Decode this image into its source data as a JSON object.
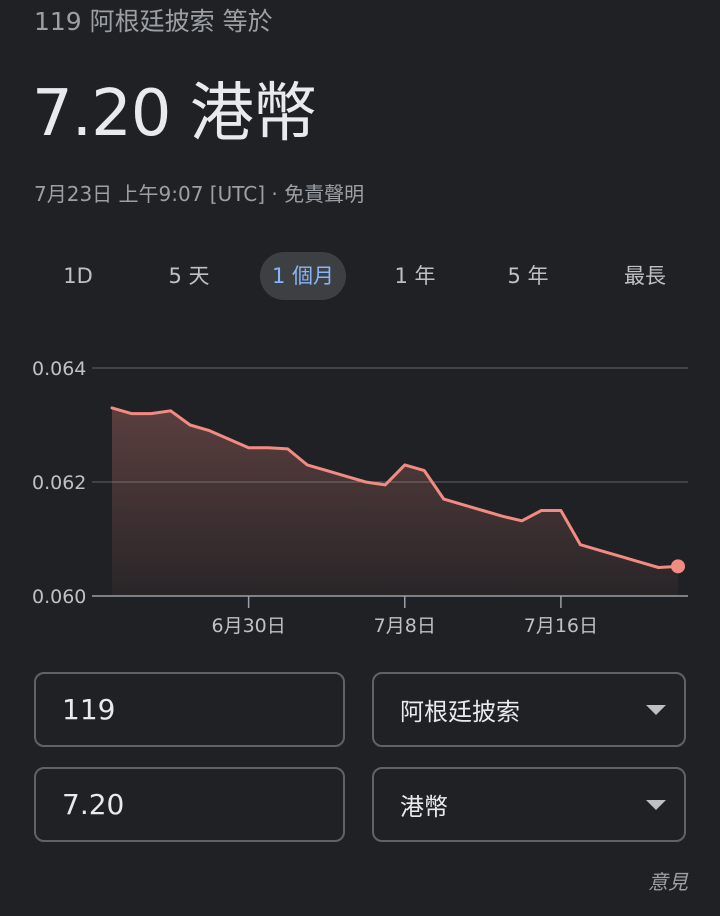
{
  "header": {
    "subtitle": "119 阿根廷披索 等於",
    "value": "7.20 港幣",
    "timestamp": "7月23日 上午9:07 [UTC] · 免責聲明"
  },
  "tabs": [
    {
      "label": "1D",
      "active": false
    },
    {
      "label": "5 天",
      "active": false
    },
    {
      "label": "1 個月",
      "active": true
    },
    {
      "label": "1 年",
      "active": false
    },
    {
      "label": "5 年",
      "active": false
    },
    {
      "label": "最長",
      "active": false
    }
  ],
  "chart_data": {
    "type": "area",
    "title": "",
    "xlabel": "",
    "ylabel": "",
    "ylim": [
      0.06,
      0.064
    ],
    "yticks": [
      0.06,
      0.062,
      0.064
    ],
    "ytick_labels": [
      "0.060",
      "0.062",
      "0.064"
    ],
    "xticks": [
      {
        "index": 7,
        "label": "6月30日"
      },
      {
        "index": 15,
        "label": "7月8日"
      },
      {
        "index": 23,
        "label": "7月16日"
      }
    ],
    "line_color": "#f28b82",
    "grid": true,
    "series": [
      {
        "values": [
          0.0633,
          0.0632,
          0.0632,
          0.06325,
          0.063,
          0.0629,
          0.06275,
          0.0626,
          0.0626,
          0.06258,
          0.0623,
          0.0622,
          0.0621,
          0.062,
          0.06195,
          0.0623,
          0.0622,
          0.0617,
          0.0616,
          0.0615,
          0.0614,
          0.06132,
          0.0615,
          0.0615,
          0.0609,
          0.0608,
          0.0607,
          0.0606,
          0.0605,
          0.06052
        ]
      }
    ]
  },
  "converter": {
    "from_amount": "119",
    "from_currency": "阿根廷披索",
    "to_amount": "7.20",
    "to_currency": "港幣"
  },
  "footer": {
    "feedback": "意見"
  }
}
